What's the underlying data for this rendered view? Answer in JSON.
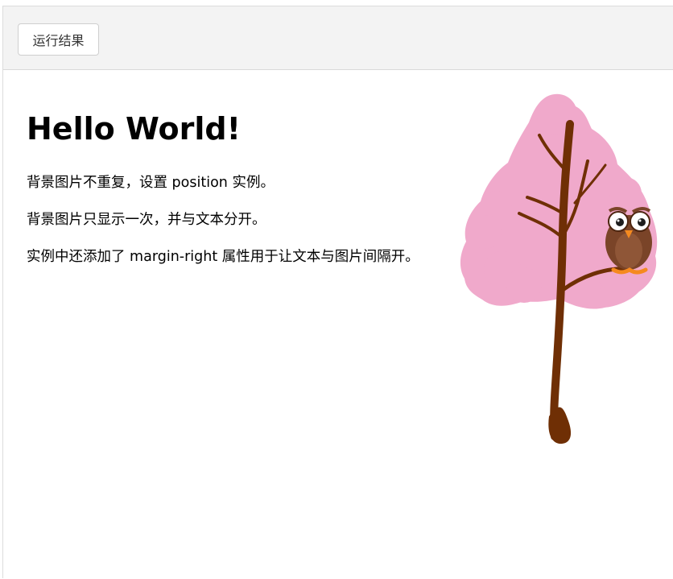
{
  "toolbar": {
    "run_button_label": "运行结果"
  },
  "page": {
    "heading": "Hello World!",
    "paragraphs": [
      "背景图片不重复，设置 position 实例。",
      "背景图片只显示一次，并与文本分开。",
      "实例中还添加了 margin-right 属性用于让文本与图片间隔开。"
    ]
  },
  "background_image": {
    "icon": "tree-with-owl",
    "colors": {
      "foliage": "#f0a9cb",
      "trunk": "#6f2f05",
      "owl_body": "#7a4428",
      "owl_feet": "#f58a1f"
    }
  }
}
